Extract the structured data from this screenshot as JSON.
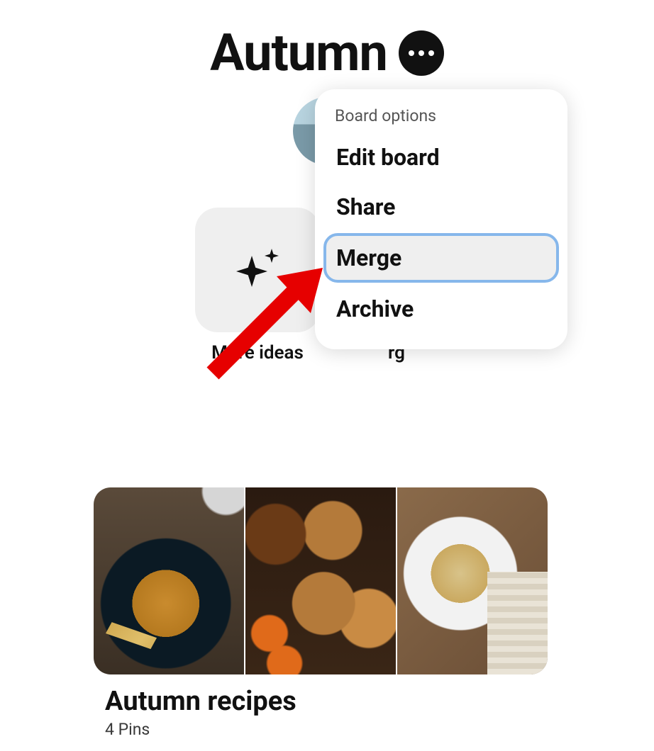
{
  "board": {
    "title": "Autumn"
  },
  "actions": {
    "more_ideas": "More ideas",
    "organize_partial": "rg"
  },
  "menu": {
    "heading": "Board options",
    "edit": "Edit board",
    "share": "Share",
    "merge": "Merge",
    "archive": "Archive"
  },
  "section": {
    "title": "Autumn recipes",
    "pin_count": "4 Pins"
  }
}
